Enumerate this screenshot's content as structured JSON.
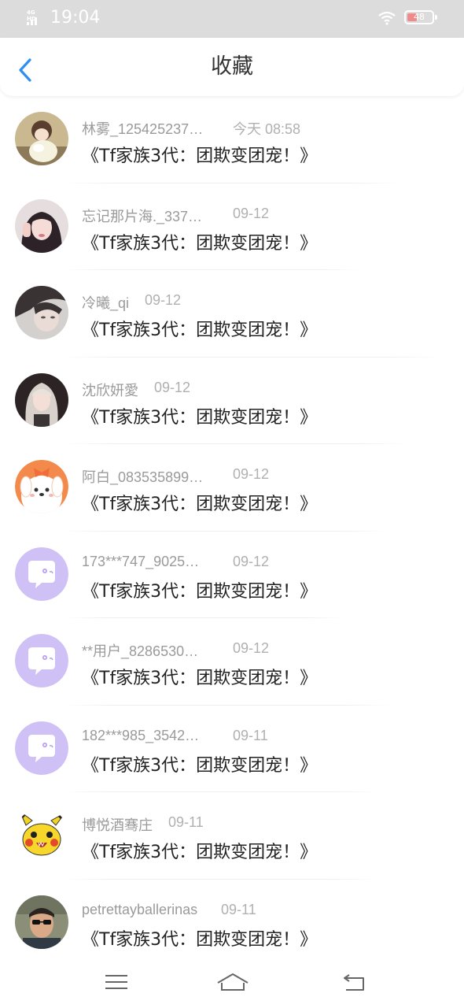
{
  "status": {
    "network": "4G HD",
    "time": "19:04",
    "battery": "48"
  },
  "header": {
    "title": "收藏"
  },
  "items": [
    {
      "name": "林雾_125425237…",
      "time": "今天 08:58",
      "message": "《Tf家族3代：团欺变团宠！》",
      "avatar": "photo-girl-cartoon"
    },
    {
      "name": "忘记那片海._337…",
      "time": "09-12",
      "message": "《Tf家族3代：团欺变团宠！》",
      "avatar": "photo-girl-wave"
    },
    {
      "name": "冷曦_qi",
      "time": "09-12",
      "message": "《Tf家族3代：团欺变团宠！》",
      "avatar": "photo-dark-girl"
    },
    {
      "name": "沈欣妍愛",
      "time": "09-12",
      "message": "《Tf家族3代：团欺变团宠！》",
      "avatar": "photo-blonde-girl"
    },
    {
      "name": "阿白_083535899…",
      "time": "09-12",
      "message": "《Tf家族3代：团欺变团宠！》",
      "avatar": "cartoon-dog"
    },
    {
      "name": "173***747_9025…",
      "time": "09-12",
      "message": "《Tf家族3代：团欺变团宠！》",
      "avatar": "default-chat"
    },
    {
      "name": "**用户_8286530…",
      "time": "09-12",
      "message": "《Tf家族3代：团欺变团宠！》",
      "avatar": "default-chat"
    },
    {
      "name": "182***985_3542…",
      "time": "09-11",
      "message": "《Tf家族3代：团欺变团宠！》",
      "avatar": "default-chat"
    },
    {
      "name": "博悦酒骞庄",
      "time": "09-11",
      "message": "《Tf家族3代：团欺变团宠！》",
      "avatar": "pikachu"
    },
    {
      "name": "petrettayballerinas",
      "time": "09-11",
      "message": "《Tf家族3代：团欺变团宠！》",
      "avatar": "photo-man-sunglasses"
    }
  ],
  "nav": {
    "menu": "menu-icon",
    "home": "home-icon",
    "back": "back-icon"
  },
  "colors": {
    "accent": "#2e8ff0",
    "avatar_default": "#cfc0f5"
  }
}
